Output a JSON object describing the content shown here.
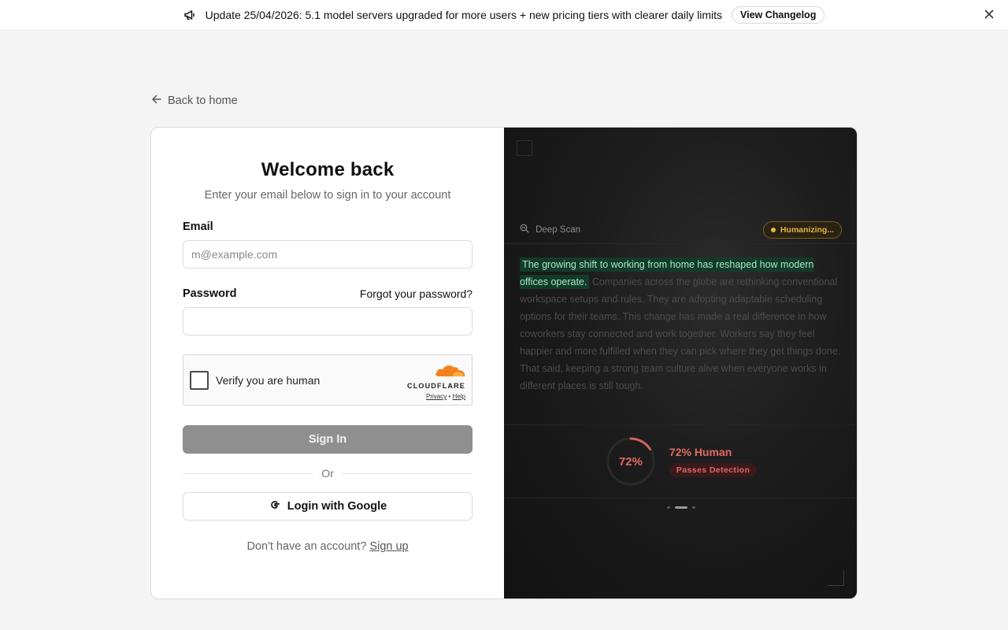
{
  "banner": {
    "text": "Update 25/04/2026: 5.1 model servers upgraded for more users + new pricing tiers with clearer daily limits",
    "button_label": "View Changelog",
    "icon": "megaphone-icon",
    "close_icon": "close-icon"
  },
  "back_link": {
    "label": "Back to home",
    "icon": "arrow-left-icon"
  },
  "login": {
    "title": "Welcome back",
    "subtitle": "Enter your email below to sign in to your account",
    "email_label": "Email",
    "email_placeholder": "m@example.com",
    "email_value": "",
    "password_label": "Password",
    "forgot_label": "Forgot your password?",
    "password_value": "",
    "captcha": {
      "text": "Verify you are human",
      "brand": "CLOUDFLARE",
      "privacy": "Privacy",
      "separator": "•",
      "help": "Help"
    },
    "signin_label": "Sign In",
    "or_label": "Or",
    "google_label": "Login with Google",
    "signup_prompt": "Don't have an account?",
    "signup_link": "Sign up"
  },
  "preview": {
    "scan_label": "Deep Scan",
    "status": "Humanizing...",
    "highlighted_text": "The growing shift to working from home has reshaped how modern offices operate.",
    "body_text": "Companies across the globe are rethinking conventional workspace setups and rules.   They are adopting adaptable scheduling options for their teams.   This change has made a real difference in how coworkers stay connected and work together.   Workers say they feel happier and more fulfilled when they can pick where they get things done.   That said, keeping a strong team culture alive when everyone works in different places is still tough.",
    "score_percent": 72,
    "score_label": "72%",
    "result_title": "72% Human",
    "result_badge": "Passes Detection",
    "carousel_count": 3,
    "carousel_active": 1,
    "colors": {
      "accent_red": "#e06a63",
      "status_yellow": "#e2b443",
      "highlight_green": "#a9e6c6"
    }
  }
}
